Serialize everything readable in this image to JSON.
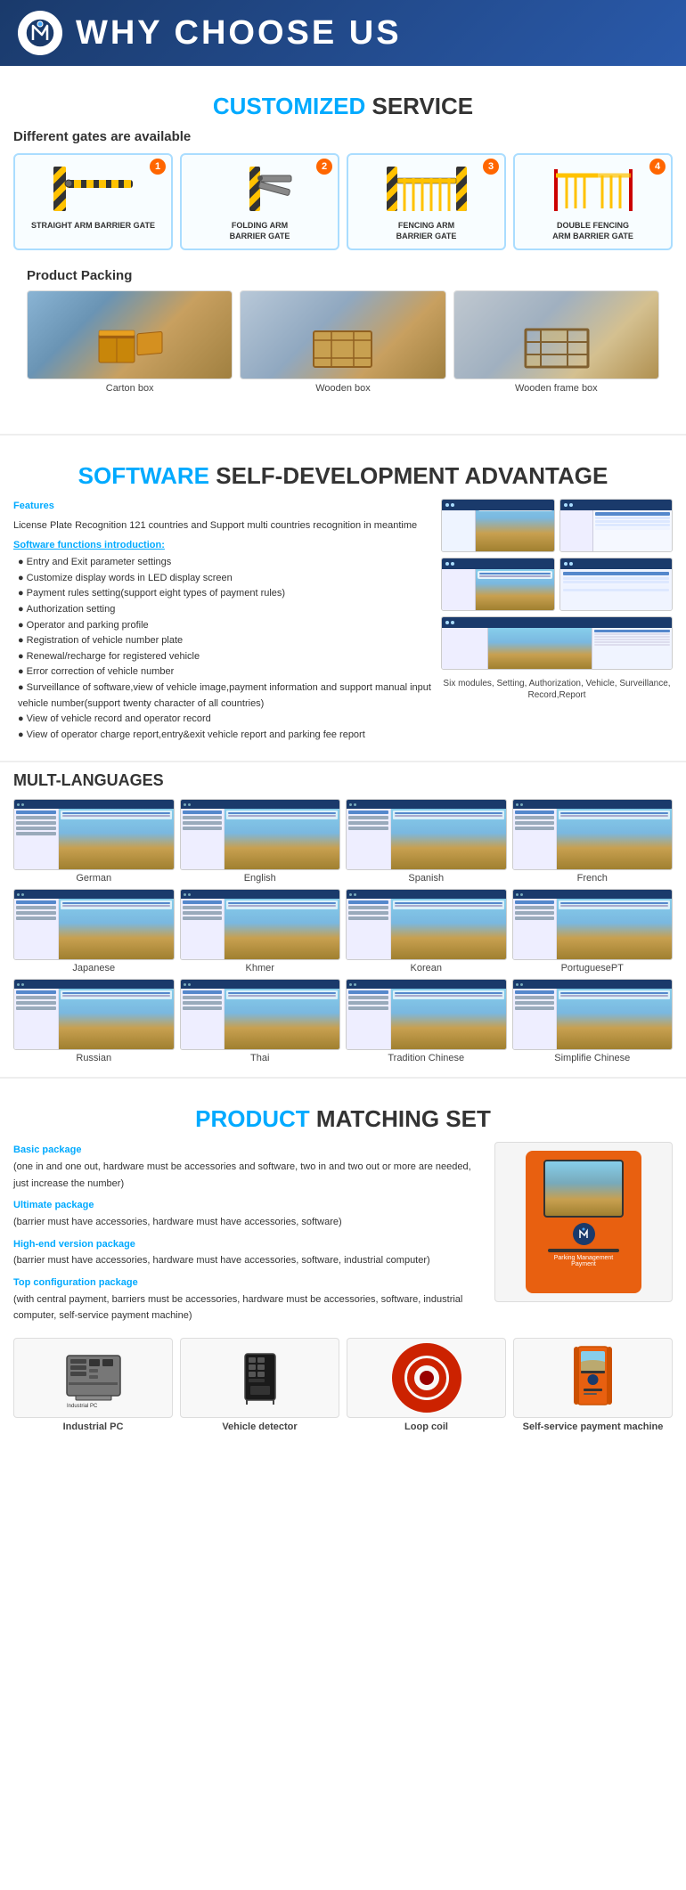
{
  "header": {
    "title": "WHY CHOOSE US",
    "logo_symbol": "N"
  },
  "customized_service": {
    "section_title_highlight": "CUSTOMIZED",
    "section_title_rest": " SERVICE",
    "subtitle": "Different gates are available",
    "gates": [
      {
        "num": "1",
        "label": "STRAIGHT ARM\nBARRIER GATE"
      },
      {
        "num": "2",
        "label": "FOLDING ARM\nBARRIER GATE"
      },
      {
        "num": "3",
        "label": "FENCING ARM\nBARRIER GATE"
      },
      {
        "num": "4",
        "label": "DOUBLE FENCING\nARM BARRIER GATE"
      }
    ],
    "packing_title": "Product Packing",
    "packing_items": [
      {
        "label": "Carton box"
      },
      {
        "label": "Wooden box"
      },
      {
        "label": "Wooden frame box"
      }
    ]
  },
  "software": {
    "section_title_highlight": "SOFTWARE",
    "section_title_rest": " SELF-DEVELOPMENT\nADVANTAGE",
    "features_title": "Features",
    "features_text": "License Plate Recognition 121 countries and Support multi countries recognition in meantime",
    "functions_title": "Software functions introduction:",
    "functions": [
      "Entry and Exit parameter settings",
      "Customize display words in LED display screen",
      "Payment rules setting(support eight types of payment rules)",
      "Authorization setting",
      "Operator and parking profile",
      "Registration of vehicle number plate",
      "Renewal/recharge for registered vehicle",
      "Error correction of vehicle number",
      "Surveillance of software,view of vehicle image,payment information and support manual input vehicle number(support twenty character of all countries)",
      "View of vehicle record and operator record",
      "View of operator charge report,entry&exit vehicle report and parking fee report"
    ],
    "caption": "Six modules, Setting, Authorization, Vehicle,\nSurveillance, Record,Report"
  },
  "languages": {
    "section_title": "MULT-LANGUAGES",
    "items": [
      "German",
      "English",
      "Spanish",
      "French",
      "Japanese",
      "Khmer",
      "Korean",
      "PortuguesePT",
      "Russian",
      "Thai",
      "Tradition Chinese",
      "Simplifie Chinese"
    ]
  },
  "product_matching": {
    "section_title_highlight": "PRODUCT",
    "section_title_rest": " MATCHING SET",
    "packages": [
      {
        "title": "Basic package",
        "desc": "(one in and one out, hardware must be accessories and software, two in and two out or more are needed, just increase the number)"
      },
      {
        "title": "Ultimate package",
        "desc": "(barrier must have accessories, hardware must have accessories, software)"
      },
      {
        "title": "High-end version package",
        "desc": "(barrier must have accessories, hardware must have accessories, software, industrial computer)"
      },
      {
        "title": "Top configuration package",
        "desc": "(with central payment, barriers must be accessories, hardware must be accessories, software, industrial computer, self-service payment machine)"
      }
    ],
    "machine_text": "Parking Management Payment",
    "hardware": [
      {
        "label": "Industrial PC"
      },
      {
        "label": "Vehicle detector"
      },
      {
        "label": "Loop coil"
      },
      {
        "label": "Self-service payment machine"
      }
    ]
  }
}
